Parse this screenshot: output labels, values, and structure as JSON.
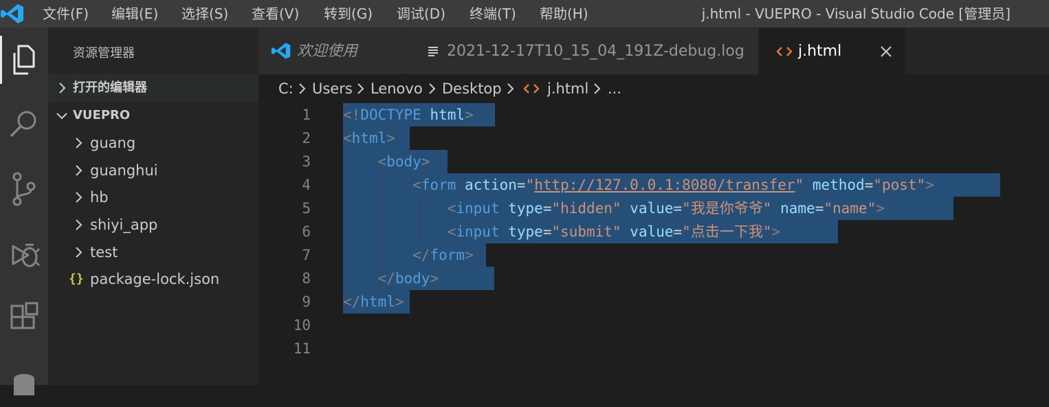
{
  "titlebar": {
    "menu": [
      "文件(F)",
      "编辑(E)",
      "选择(S)",
      "查看(V)",
      "转到(G)",
      "调试(D)",
      "终端(T)",
      "帮助(H)"
    ],
    "window_title": "j.html - VUEPRO - Visual Studio Code [管理员]"
  },
  "activitybar": {
    "icons": [
      "explorer-icon",
      "search-icon",
      "source-control-icon",
      "debug-icon",
      "extensions-icon",
      "database-icon"
    ]
  },
  "sidebar": {
    "title": "资源管理器",
    "open_editors": "打开的编辑器",
    "project": "VUEPRO",
    "items": [
      {
        "label": "guang",
        "type": "folder"
      },
      {
        "label": "guanghui",
        "type": "folder"
      },
      {
        "label": "hb",
        "type": "folder"
      },
      {
        "label": "shiyi_app",
        "type": "folder"
      },
      {
        "label": "test",
        "type": "folder"
      },
      {
        "label": "package-lock.json",
        "type": "json",
        "icon_text": "{}"
      }
    ]
  },
  "tabs": [
    {
      "label": "欢迎使用",
      "active": false
    },
    {
      "label": "2021-12-17T10_15_04_191Z-debug.log",
      "active": false
    },
    {
      "label": "j.html",
      "active": true
    }
  ],
  "breadcrumb": [
    "C:",
    "Users",
    "Lenovo",
    "Desktop",
    "j.html",
    "..."
  ],
  "editor": {
    "line_numbers": [
      "1",
      "2",
      "3",
      "4",
      "5",
      "6",
      "7",
      "8",
      "9",
      "10",
      "11"
    ],
    "lines": {
      "l1": {
        "open": "<!",
        "doctype": "DOCTYPE",
        "sp": " ",
        "html": "html",
        "close": ">"
      },
      "l2": {
        "open": "<",
        "tag": "html",
        "close": ">"
      },
      "l3": {
        "indent": "    ",
        "open": "<",
        "tag": "body",
        "close": ">"
      },
      "l4": {
        "indent": "        ",
        "open": "<",
        "tag": "form",
        "a1": "action",
        "eq1": "=",
        "q1a": "\"",
        "v1": "http://127.0.0.1:8080/transfer",
        "q1b": "\"",
        "a2": "method",
        "eq2": "=",
        "v2": "\"post\"",
        "close": ">"
      },
      "l5": {
        "indent": "            ",
        "open": "<",
        "tag": "input",
        "a1": "type",
        "eq1": "=",
        "v1": "\"hidden\"",
        "a2": "value",
        "eq2": "=",
        "v2": "\"我是你爷爷\"",
        "a3": "name",
        "eq3": "=",
        "v3": "\"name\"",
        "close": ">"
      },
      "l6": {
        "indent": "            ",
        "open": "<",
        "tag": "input",
        "a1": "type",
        "eq1": "=",
        "v1": "\"submit\"",
        "a2": "value",
        "eq2": "=",
        "v2": "\"点击一下我\"",
        "close": ">"
      },
      "l7": {
        "indent": "        ",
        "open": "</",
        "tag": "form",
        "close": ">"
      },
      "l8": {
        "indent": "    ",
        "open": "</",
        "tag": "body",
        "close": ">"
      },
      "l9": {
        "open": "</",
        "tag": "html",
        "close": ">"
      }
    }
  },
  "colors": {
    "accent": "#007acc",
    "selection": "#264f78",
    "tag": "#569cd6",
    "attribute": "#9cdcfe",
    "string": "#ce9178"
  }
}
